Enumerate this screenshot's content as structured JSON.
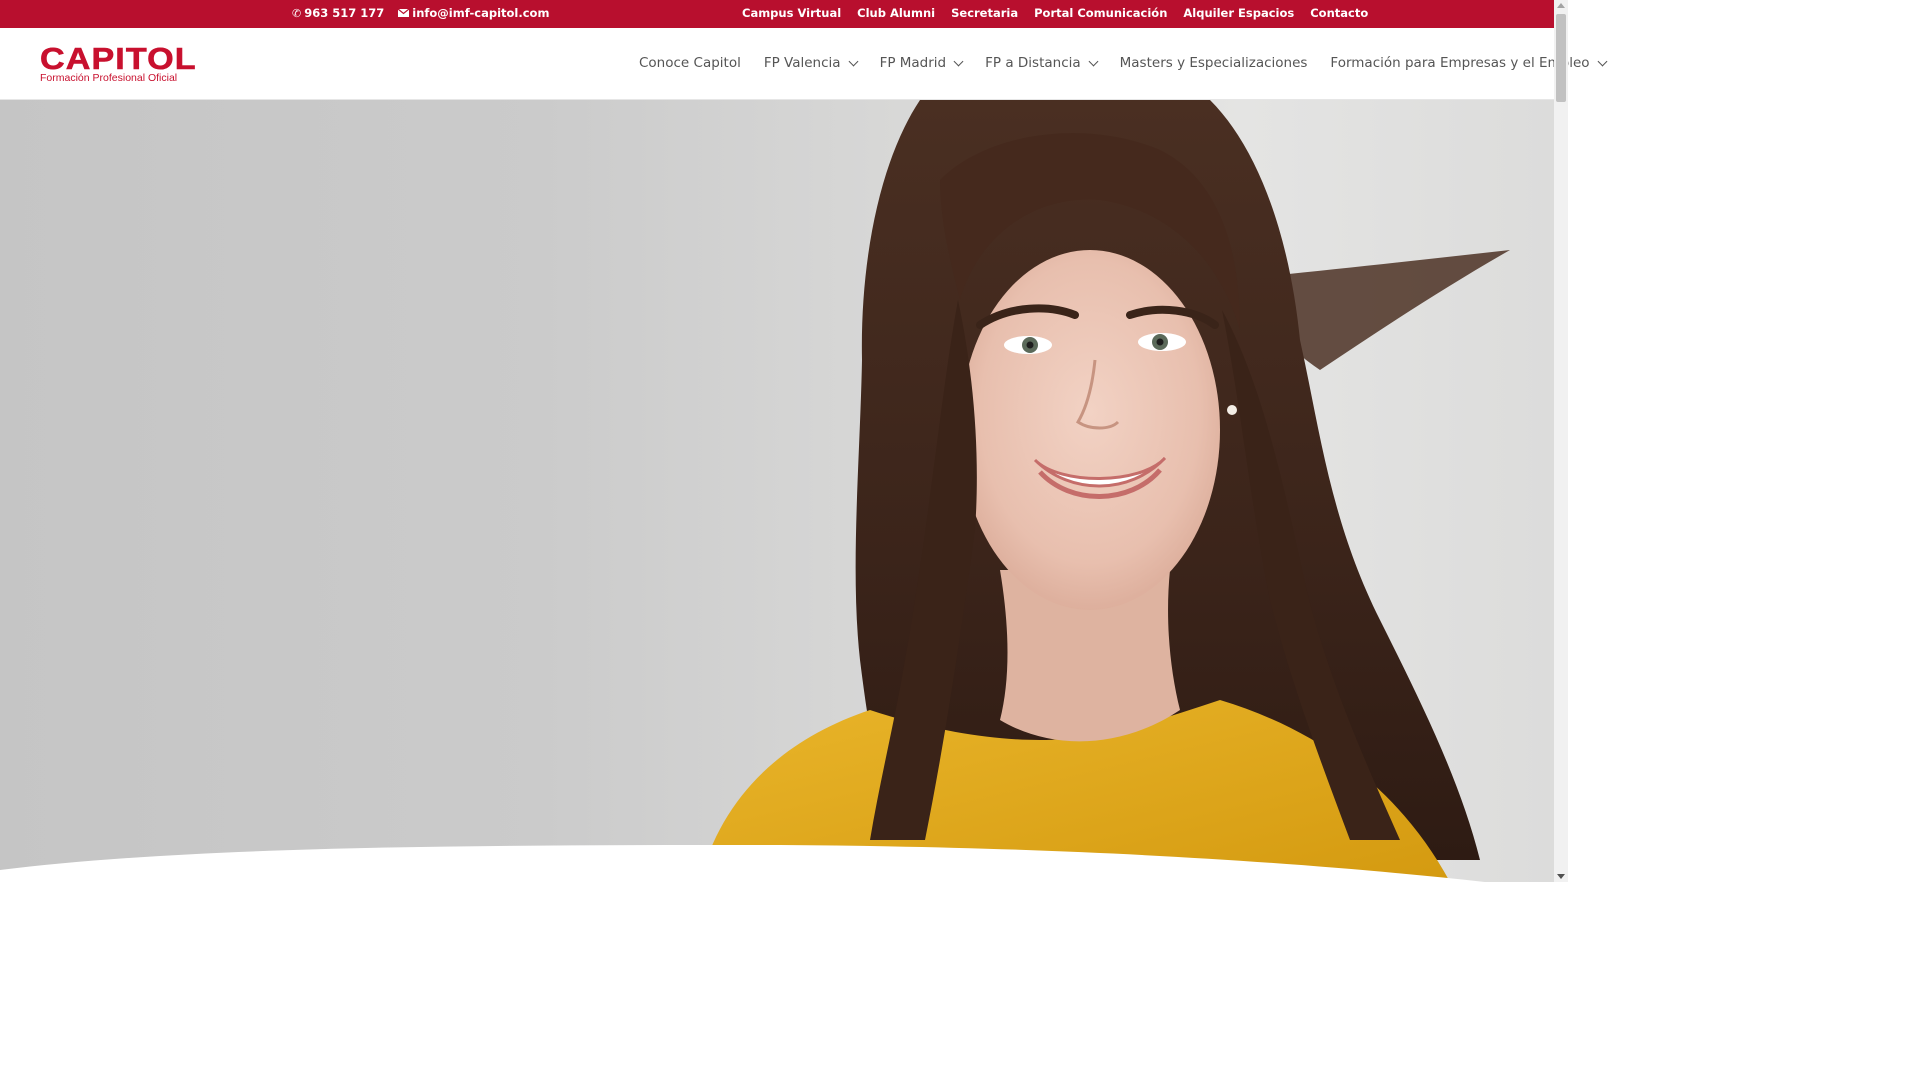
{
  "topbar": {
    "phone": "963 517 177",
    "email": "info@imf-capitol.com",
    "links": [
      "Campus Virtual",
      "Club Alumni",
      "Secretaria",
      "Portal Comunicación",
      "Alquiler Espacios",
      "Contacto"
    ],
    "bg_color": "#b80f2e"
  },
  "logo": {
    "name": "CAPITOL",
    "tagline": "Formación Profesional Oficial",
    "color": "#c8102e"
  },
  "nav": {
    "items": [
      {
        "label": "Conoce Capitol",
        "dropdown": false
      },
      {
        "label": "FP Valencia",
        "dropdown": true
      },
      {
        "label": "FP Madrid",
        "dropdown": true
      },
      {
        "label": "FP a Distancia",
        "dropdown": true
      },
      {
        "label": "Masters y Especializaciones",
        "dropdown": false
      },
      {
        "label": "Formación para Empresas y el Empleo",
        "dropdown": true
      }
    ]
  },
  "hero": {
    "image": "smiling-woman-yellow-shirt"
  },
  "icons": {
    "phone": "phone-icon",
    "email": "envelope-icon",
    "dropdown": "chevron-down-icon"
  }
}
